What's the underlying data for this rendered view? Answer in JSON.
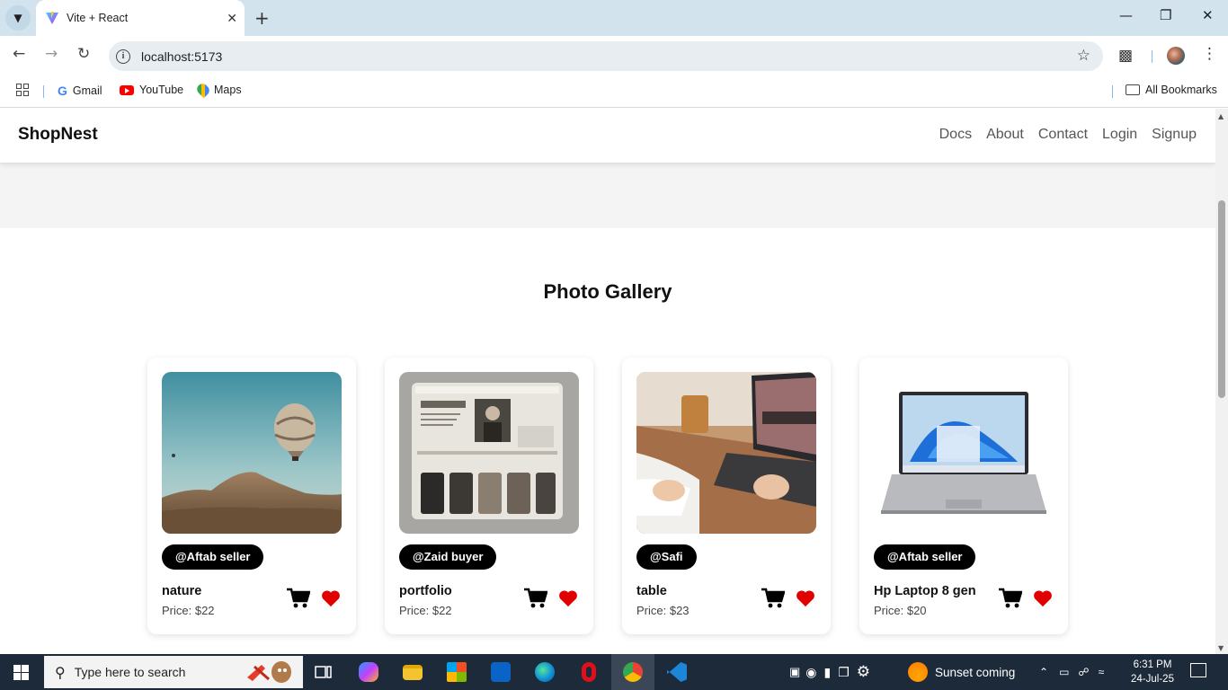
{
  "browser": {
    "tab_title": "Vite + React",
    "url": "localhost:5173",
    "bookmarks": [
      {
        "label": "Gmail",
        "icon": "gmail-icon"
      },
      {
        "label": "YouTube",
        "icon": "youtube-icon"
      },
      {
        "label": "Maps",
        "icon": "maps-icon"
      }
    ],
    "all_bookmarks_label": "All Bookmarks"
  },
  "site": {
    "brand": "ShopNest",
    "nav": [
      "Docs",
      "About",
      "Contact",
      "Login",
      "Signup"
    ],
    "gallery_title": "Photo Gallery"
  },
  "products": [
    {
      "seller": "@Aftab seller",
      "name": "nature",
      "price": "Price: $22",
      "image": "hot-air-balloon-over-hills"
    },
    {
      "seller": "@Zaid buyer",
      "name": "portfolio",
      "price": "Price: $22",
      "image": "portfolio-website-mockup"
    },
    {
      "seller": "@Safi",
      "name": "table",
      "price": "Price: $23",
      "image": "laptop-online-course-on-desk"
    },
    {
      "seller": "@Aftab seller",
      "name": "Hp Laptop 8 gen",
      "price": "Price: $20",
      "image": "silver-laptop-windows-11"
    }
  ],
  "taskbar": {
    "search_placeholder": "Type here to search",
    "weather": "Sunset coming",
    "time": "6:31 PM",
    "date": "24-Jul-25"
  },
  "colors": {
    "accent_black": "#000000",
    "heart_red": "#e00000",
    "tabstrip": "#d3e3ed",
    "taskbar": "#1d2a3a"
  }
}
